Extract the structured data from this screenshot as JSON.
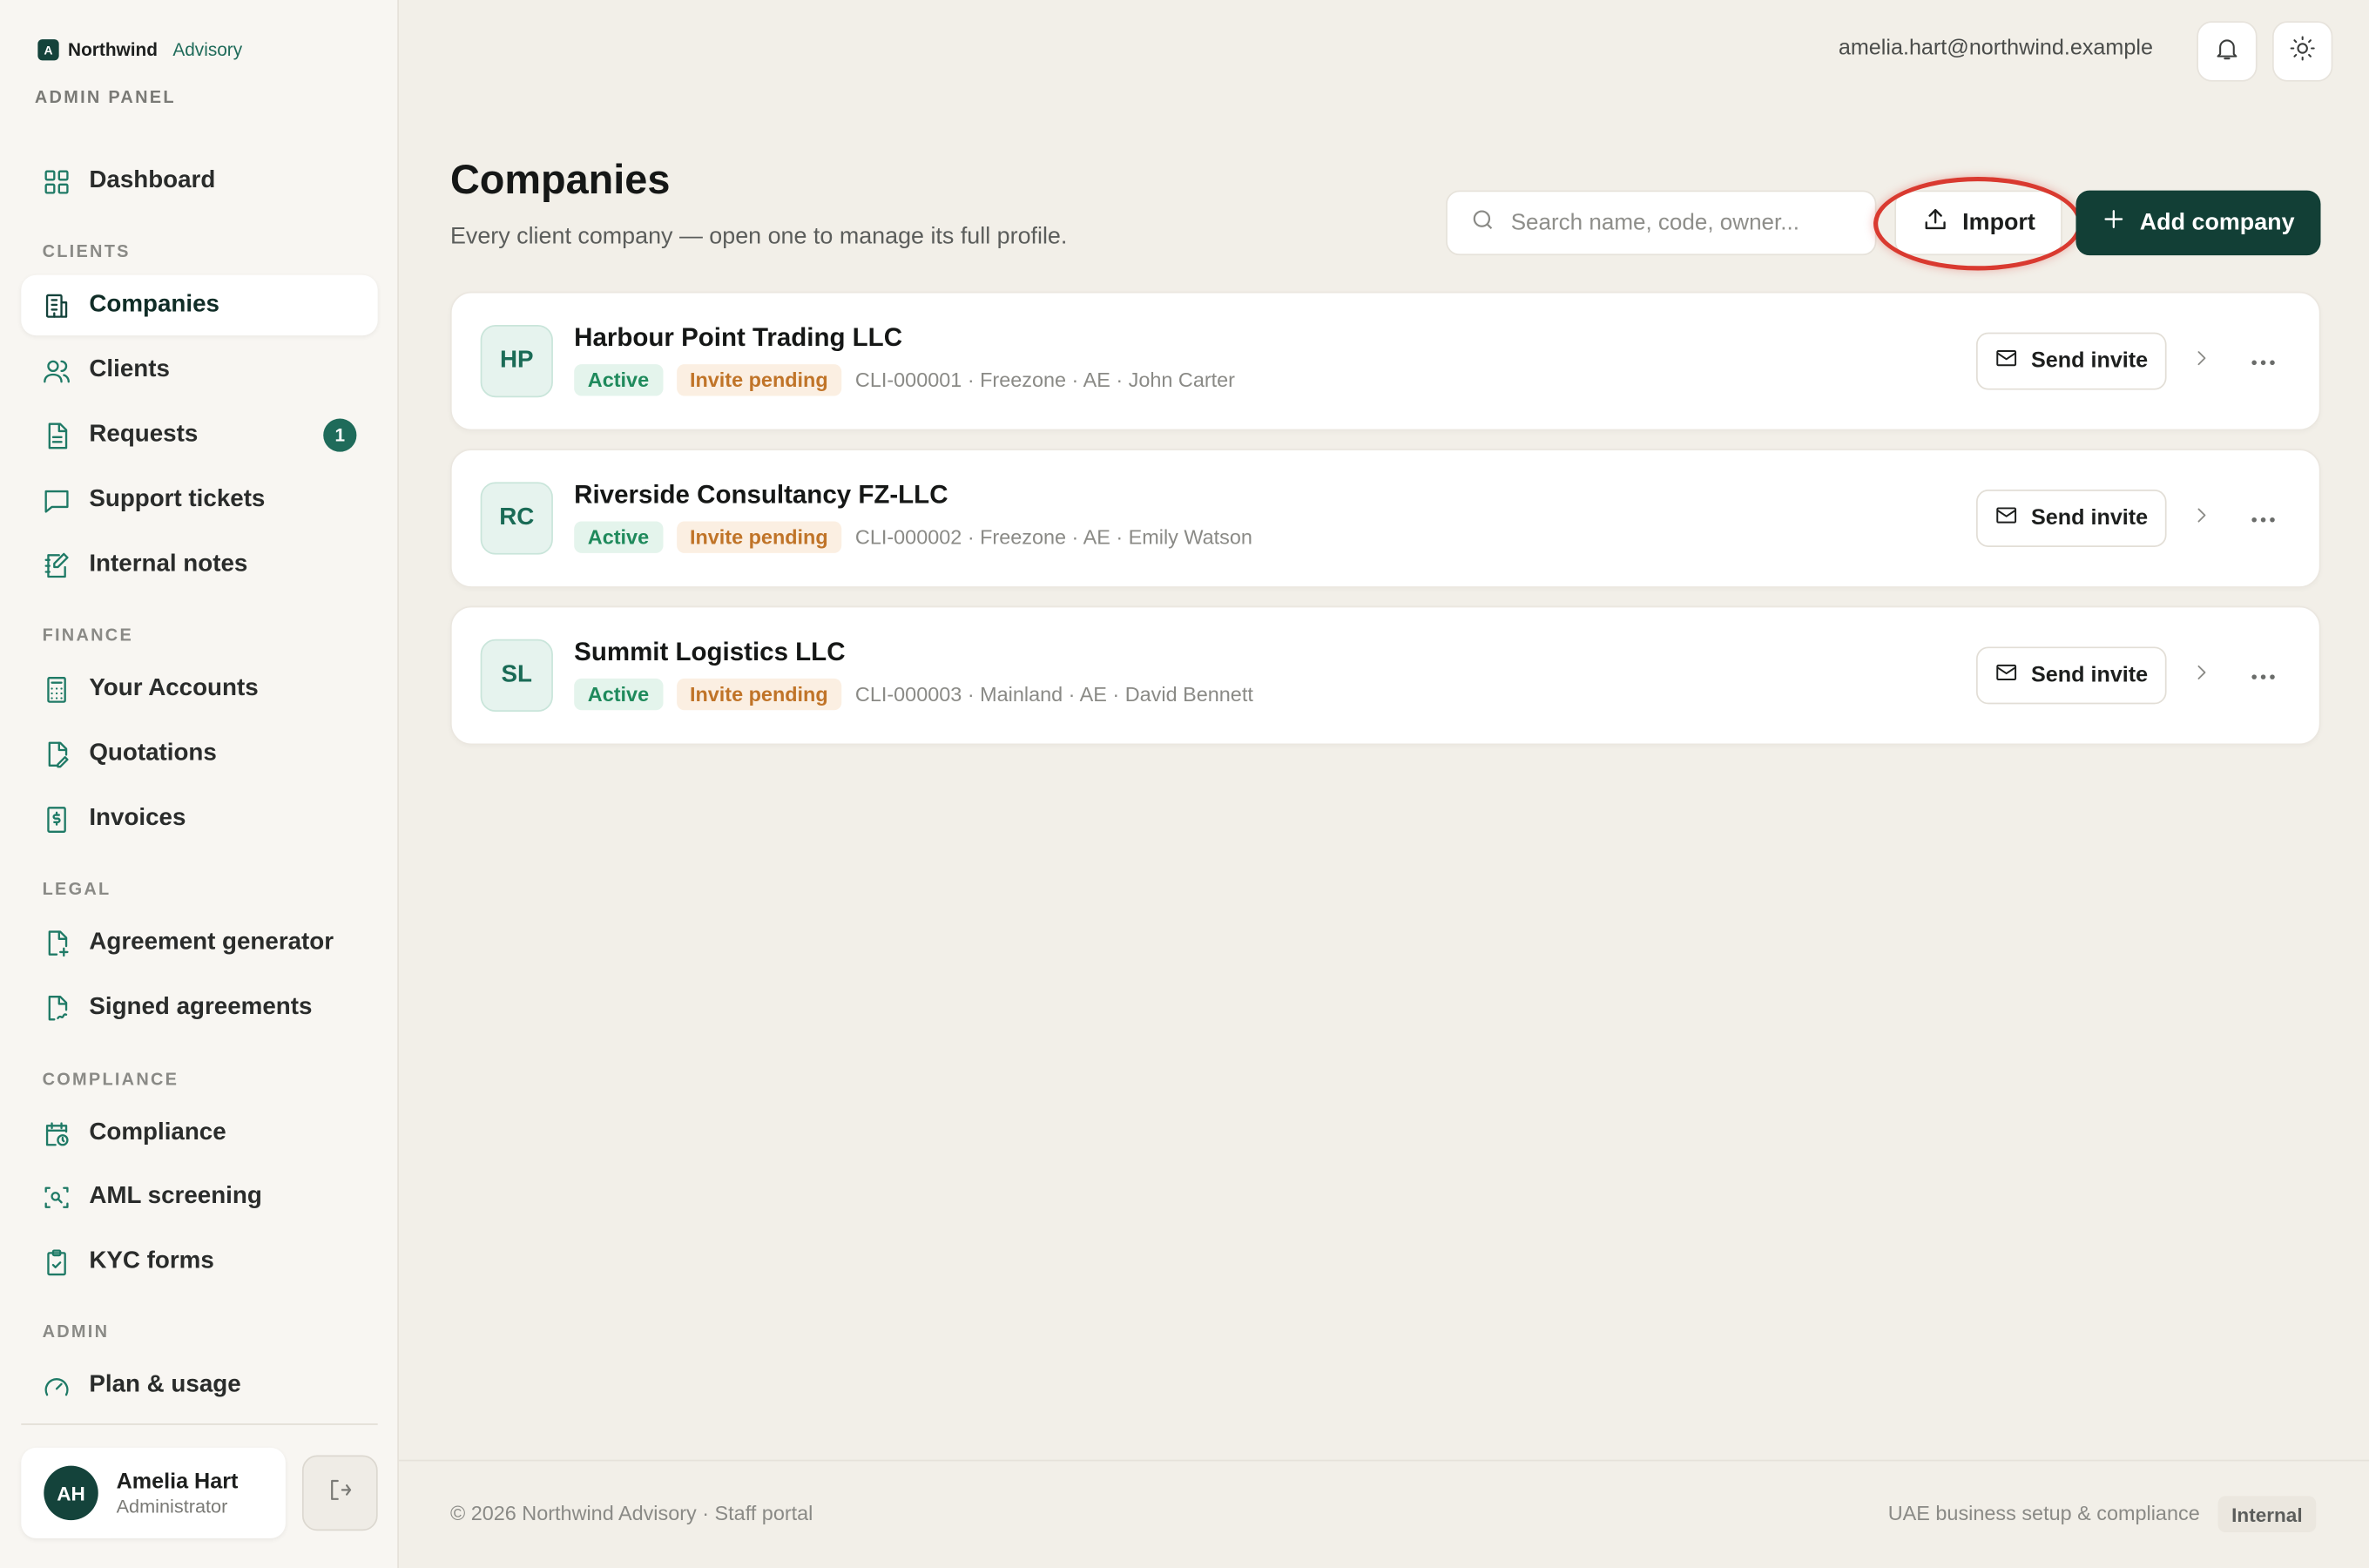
{
  "brand": {
    "name": "Northwind",
    "suffix": "Advisory",
    "logo_letter": "A"
  },
  "sidebar": {
    "panel_label": "ADMIN PANEL",
    "sections": {
      "clients": "CLIENTS",
      "finance": "FINANCE",
      "legal": "LEGAL",
      "compliance": "COMPLIANCE",
      "admin": "ADMIN"
    },
    "items": [
      {
        "label": "Dashboard",
        "icon": "grid-icon"
      },
      {
        "label": "Companies",
        "icon": "building-icon",
        "active": true
      },
      {
        "label": "Clients",
        "icon": "users-icon"
      },
      {
        "label": "Requests",
        "icon": "file-text-icon",
        "badge": "1"
      },
      {
        "label": "Support tickets",
        "icon": "message-icon"
      },
      {
        "label": "Internal notes",
        "icon": "notebook-pen-icon"
      },
      {
        "label": "Your Accounts",
        "icon": "calculator-icon"
      },
      {
        "label": "Quotations",
        "icon": "file-pen-icon"
      },
      {
        "label": "Invoices",
        "icon": "receipt-icon"
      },
      {
        "label": "Agreement generator",
        "icon": "file-plus-icon"
      },
      {
        "label": "Signed agreements",
        "icon": "file-signature-icon"
      },
      {
        "label": "Compliance",
        "icon": "calendar-clock-icon"
      },
      {
        "label": "AML screening",
        "icon": "scan-search-icon"
      },
      {
        "label": "KYC forms",
        "icon": "clipboard-check-icon"
      },
      {
        "label": "Plan & usage",
        "icon": "gauge-icon"
      }
    ],
    "user": {
      "initials": "AH",
      "name": "Amelia Hart",
      "role": "Administrator"
    }
  },
  "topbar": {
    "email": "amelia.hart@northwind.example"
  },
  "page": {
    "title": "Companies",
    "subtitle": "Every client company — open one to manage its full profile.",
    "search_placeholder": "Search name, code, owner...",
    "import_label": "Import",
    "add_label": "Add company"
  },
  "companies": [
    {
      "initials": "HP",
      "name": "Harbour Point Trading LLC",
      "status": "Active",
      "invite": "Invite pending",
      "info": "CLI-000001 · Freezone · AE · John Carter",
      "action": "Send invite"
    },
    {
      "initials": "RC",
      "name": "Riverside Consultancy FZ-LLC",
      "status": "Active",
      "invite": "Invite pending",
      "info": "CLI-000002 · Freezone · AE · Emily Watson",
      "action": "Send invite"
    },
    {
      "initials": "SL",
      "name": "Summit Logistics LLC",
      "status": "Active",
      "invite": "Invite pending",
      "info": "CLI-000003 · Mainland · AE · David Bennett",
      "action": "Send invite"
    }
  ],
  "footer": {
    "left": "© 2026 Northwind Advisory · Staff portal",
    "right": "UAE business setup & compliance",
    "badge": "Internal"
  },
  "colors": {
    "accent": "#123f36",
    "highlight_ring": "#d93a30",
    "active_green": "#1f8a5c",
    "pending_orange": "#c07428"
  }
}
